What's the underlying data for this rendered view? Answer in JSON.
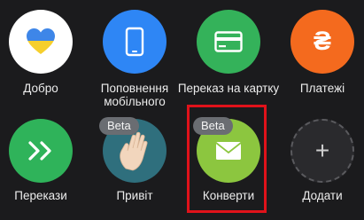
{
  "tiles": [
    {
      "label": "Добро",
      "icon": "heart-icon",
      "color": "#ffffff"
    },
    {
      "label": "Поповнення мобільного",
      "icon": "smartphone-icon",
      "color": "#2e86f5"
    },
    {
      "label": "Переказ на картку",
      "icon": "card-icon",
      "color": "#34b25a"
    },
    {
      "label": "Платежі",
      "icon": "hryvnia-icon",
      "color": "#f46a1e",
      "glyph": "₴"
    },
    {
      "label": "Перекази",
      "icon": "double-chevron-right-icon",
      "color": "#2fb35a"
    },
    {
      "label": "Привіт",
      "icon": "waving-hand-icon",
      "color": "#2f6f7d",
      "badge": "Beta"
    },
    {
      "label": "Конверти",
      "icon": "envelope-icon",
      "color": "#8cc63f",
      "badge": "Beta"
    },
    {
      "label": "Додати",
      "icon": "plus-icon",
      "color": "#2a2a2d",
      "glyph": "+"
    }
  ],
  "colors": {
    "background": "#1b1b1d",
    "highlight": "#e0121a",
    "heart_blue": "#3e86e8",
    "heart_yellow": "#f6cf2d"
  }
}
